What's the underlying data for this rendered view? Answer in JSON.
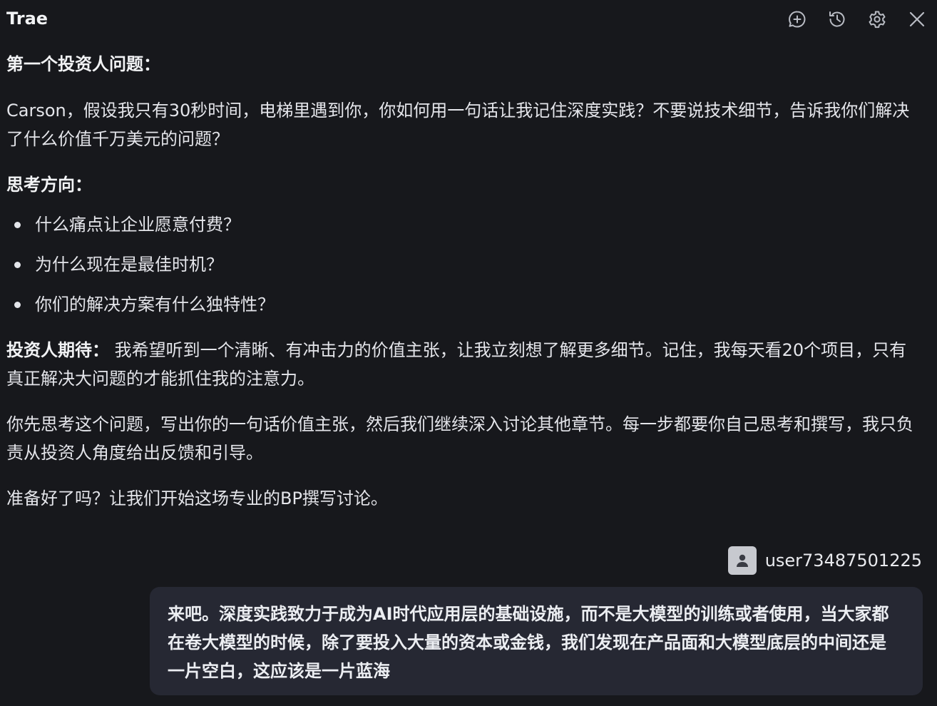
{
  "header": {
    "title": "Trae",
    "icons": [
      "new-chat-icon",
      "history-icon",
      "settings-icon",
      "close-icon"
    ]
  },
  "ai_message": {
    "heading1": "第一个投资人问题：",
    "question": "Carson，假设我只有30秒时间，电梯里遇到你，你如何用一句话让我记住深度实践？不要说技术细节，告诉我你们解决了什么价值千万美元的问题？",
    "heading2": "思考方向：",
    "bullets": [
      "什么痛点让企业愿意付费？",
      "为什么现在是最佳时机？",
      "你们的解决方案有什么独特性？"
    ],
    "expect_label": "投资人期待：",
    "expect_text": " 我希望听到一个清晰、有冲击力的价值主张，让我立刻想了解更多细节。记住，我每天看20个项目，只有真正解决大问题的才能抓住我的注意力。",
    "instruction": "你先思考这个问题，写出你的一句话价值主张，然后我们继续深入讨论其他章节。每一步都要你自己思考和撰写，我只负责从投资人角度给出反馈和引导。",
    "closing": "准备好了吗？让我们开始这场专业的BP撰写讨论。"
  },
  "user_message": {
    "username": "user73487501225",
    "text": "来吧。深度实践致力于成为AI时代应用层的基础设施，而不是大模型的训练或者使用，当大家都在卷大模型的时候，除了要投入大量的资本或金钱，我们发现在产品面和大模型底层的中间还是一片空白，这应该是一片蓝海"
  },
  "colors": {
    "background": "#17181c",
    "bubble": "#262833",
    "text": "#e4e5ea",
    "avatar": "#c7c9cf"
  }
}
